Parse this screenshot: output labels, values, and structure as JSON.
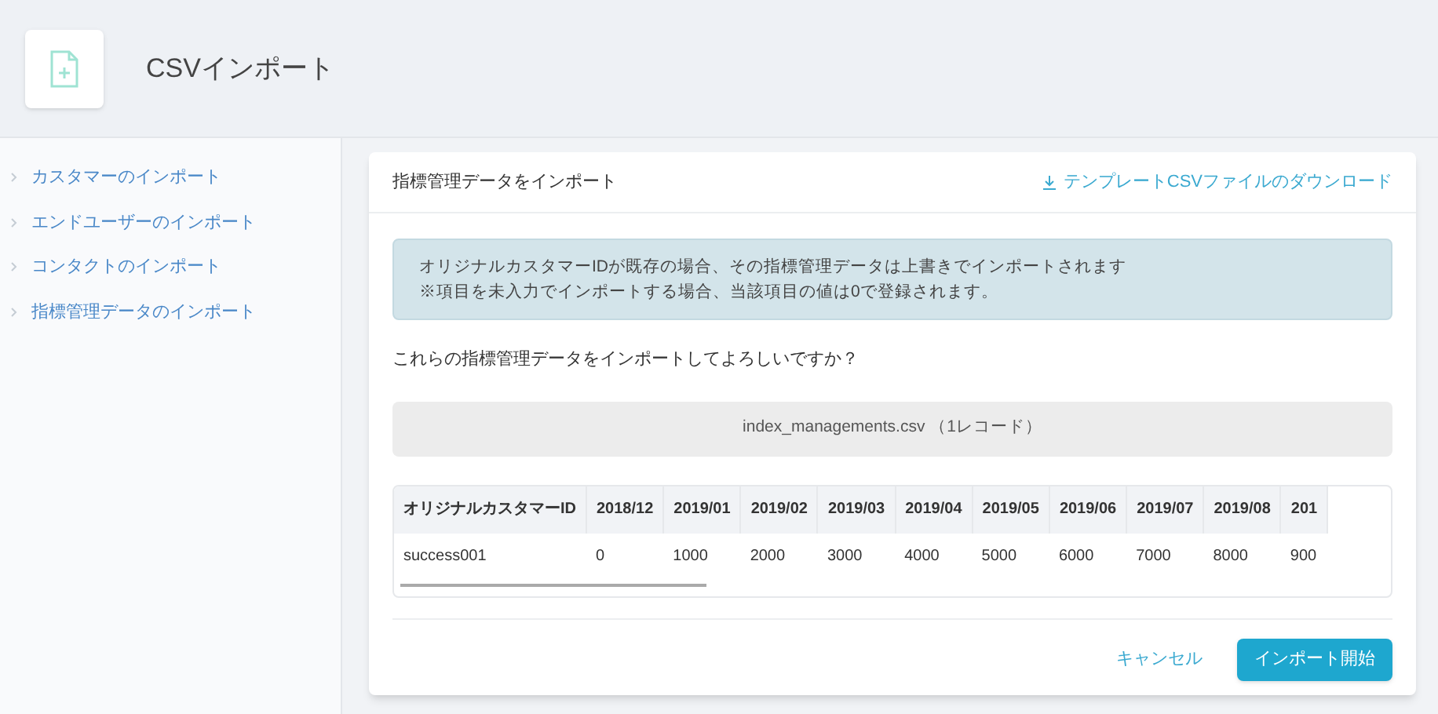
{
  "header": {
    "title": "CSVインポート"
  },
  "sidebar": {
    "items": [
      {
        "label": "カスタマーのインポート"
      },
      {
        "label": "エンドユーザーのインポート"
      },
      {
        "label": "コンタクトのインポート"
      },
      {
        "label": "指標管理データのインポート"
      }
    ]
  },
  "card": {
    "title": "指標管理データをインポート",
    "download_link": "テンプレートCSVファイルのダウンロード",
    "notice": [
      "オリジナルカスタマーIDが既存の場合、その指標管理データは上書きでインポートされます",
      "※項目を未入力でインポートする場合、当該項目の値は0で登録されます。"
    ],
    "question": "これらの指標管理データをインポートしてよろしいですか？",
    "file_label": "index_managements.csv （1レコード）",
    "table": {
      "columns": [
        "オリジナルカスタマーID",
        "2018/12",
        "2019/01",
        "2019/02",
        "2019/03",
        "2019/04",
        "2019/05",
        "2019/06",
        "2019/07",
        "2019/08",
        "201"
      ],
      "rows": [
        [
          "success001",
          "0",
          "1000",
          "2000",
          "3000",
          "4000",
          "5000",
          "6000",
          "7000",
          "8000",
          "900"
        ]
      ]
    },
    "buttons": [
      {
        "label": "キャンセル",
        "kind": "link"
      },
      {
        "label": "インポート開始",
        "kind": "primary"
      }
    ]
  }
}
